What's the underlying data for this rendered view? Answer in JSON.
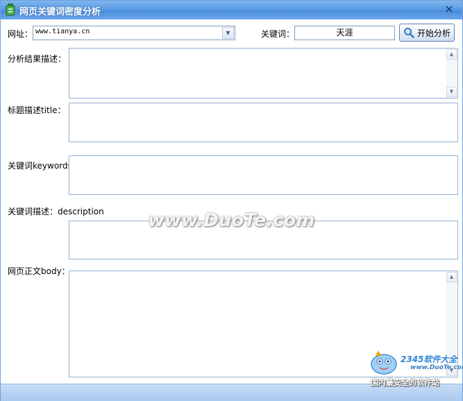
{
  "window": {
    "title": "网页关键词密度分析",
    "close_symbol": "✕"
  },
  "toolbar": {
    "url_label": "网址：",
    "url_value": "www.tianya.cn",
    "keyword_label": "关键词：",
    "keyword_value": "天涯",
    "start_button_label": "开始分析"
  },
  "fields": [
    {
      "label": "分析结果描述："
    },
    {
      "label": "标题描述title："
    },
    {
      "label": "关键词keywords"
    },
    {
      "label": "关键词描述：description"
    },
    {
      "label": "网页正文body："
    }
  ],
  "watermark": {
    "text": "www.DuoTe.com",
    "brand": "2345软件大全",
    "site": "www.DuoTe.com",
    "slogan": "国内最安全的软件站"
  },
  "icons": {
    "app": "app-icon",
    "close": "close-icon",
    "search": "magnifier-icon",
    "dropdown": "chevron-down-icon"
  },
  "colors": {
    "titlebar": "#5b9be4",
    "border": "#91b0d4",
    "statusbar": "#a9c9ee"
  }
}
